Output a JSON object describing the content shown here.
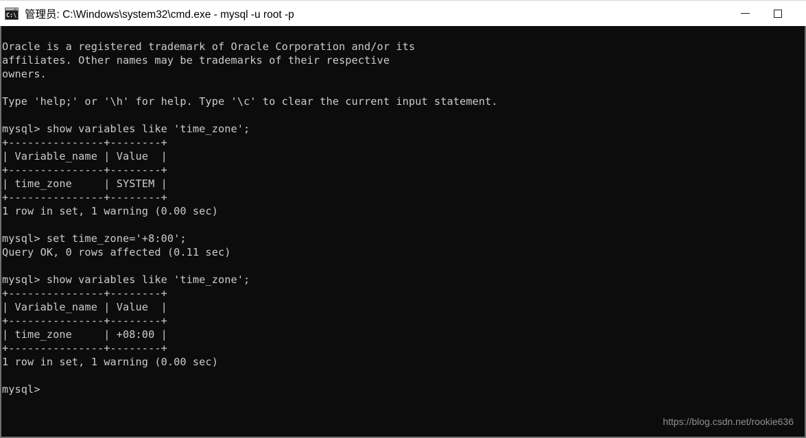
{
  "window": {
    "title": "管理员: C:\\Windows\\system32\\cmd.exe - mysql  -u root -p",
    "icon": "cmd-console-icon",
    "colors": {
      "titlebar_background": "#ffffff",
      "titlebar_text": "#000000",
      "console_background": "#0c0c0c",
      "console_text": "#cccccc",
      "window_border": "#6f7173",
      "watermark_text": "#8d9194"
    },
    "buttons": [
      {
        "name": "minimize",
        "glyph": "minimize-icon",
        "label": "最小化"
      },
      {
        "name": "maximize",
        "glyph": "maximize-icon",
        "label": "最大化"
      }
    ]
  },
  "terminal": {
    "prompt": "mysql>",
    "lines": [
      "Oracle is a registered trademark of Oracle Corporation and/or its",
      "affiliates. Other names may be trademarks of their respective",
      "owners.",
      "",
      "Type 'help;' or '\\h' for help. Type '\\c' to clear the current input statement.",
      "",
      "mysql> show variables like 'time_zone';",
      "+---------------+--------+",
      "| Variable_name | Value  |",
      "+---------------+--------+",
      "| time_zone     | SYSTEM |",
      "+---------------+--------+",
      "1 row in set, 1 warning (0.00 sec)",
      "",
      "mysql> set time_zone='+8:00';",
      "Query OK, 0 rows affected (0.11 sec)",
      "",
      "mysql> show variables like 'time_zone';",
      "+---------------+--------+",
      "| Variable_name | Value  |",
      "+---------------+--------+",
      "| time_zone     | +08:00 |",
      "+---------------+--------+",
      "1 row in set, 1 warning (0.00 sec)",
      "",
      "mysql>"
    ],
    "commands": [
      "show variables like 'time_zone';",
      "set time_zone='+8:00';",
      "show variables like 'time_zone';"
    ],
    "results": [
      {
        "headers": [
          "Variable_name",
          "Value"
        ],
        "rows": [
          [
            "time_zone",
            "SYSTEM"
          ]
        ],
        "status": "1 row in set, 1 warning (0.00 sec)"
      },
      {
        "headers": [],
        "rows": [],
        "status": "Query OK, 0 rows affected (0.11 sec)"
      },
      {
        "headers": [
          "Variable_name",
          "Value"
        ],
        "rows": [
          [
            "time_zone",
            "+08:00"
          ]
        ],
        "status": "1 row in set, 1 warning (0.00 sec)"
      }
    ]
  },
  "watermark": {
    "text": "https://blog.csdn.net/rookie636"
  }
}
